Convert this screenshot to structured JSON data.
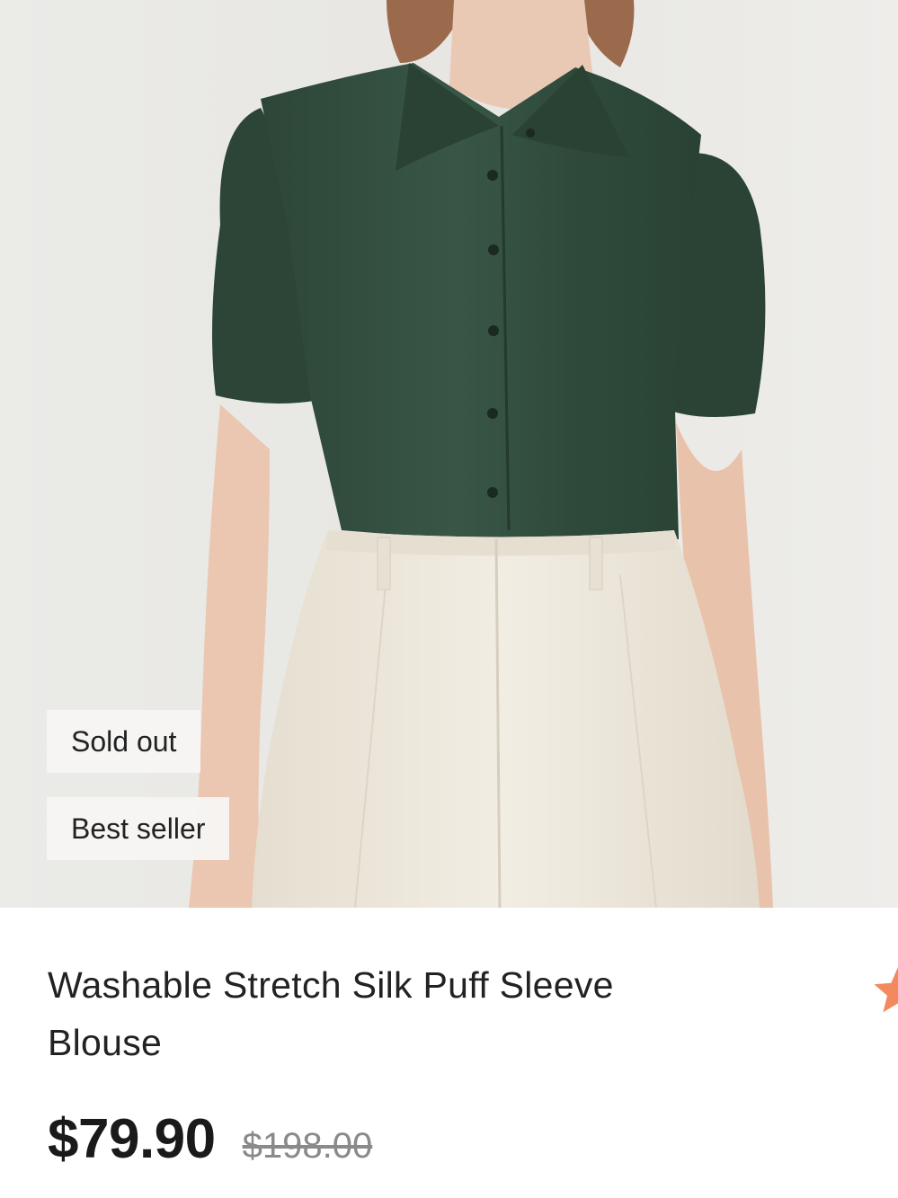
{
  "product": {
    "image_alt": "Model wearing a dark green short puff sleeve silk blouse with cream pleated trousers",
    "badges": {
      "sold_out": "Sold out",
      "best_seller": "Best seller"
    },
    "title": "Washable Stretch Silk Puff Sleeve Blouse",
    "price": "$79.90",
    "original_price": "$198.00",
    "rating_icon": "star-icon"
  },
  "colors": {
    "blouse": "#2f4a3a",
    "trousers": "#efe9dc",
    "background": "#e9e8e5",
    "star": "#f4895f"
  }
}
